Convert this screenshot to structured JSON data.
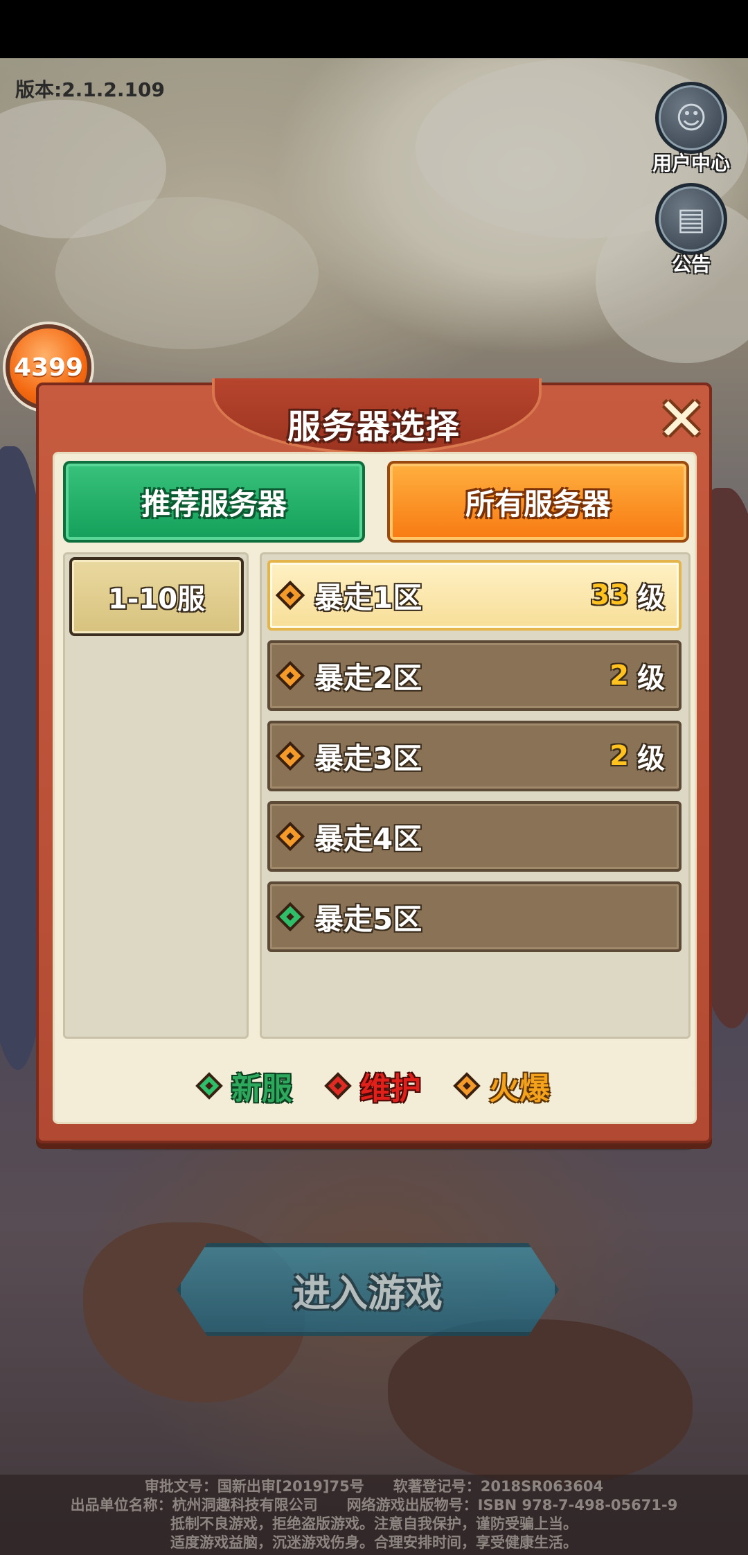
{
  "version_label": "版本:2.1.2.109",
  "side_buttons": {
    "user_center": "用户中心",
    "announcement": "公告"
  },
  "logo": "4399",
  "dialog": {
    "title": "服务器选择",
    "close_glyph": "✕",
    "tabs": {
      "recommended": "推荐服务器",
      "all": "所有服务器"
    },
    "range": "1-10服",
    "servers": [
      {
        "name": "暴走1区",
        "level": "33",
        "unit": "级",
        "status": "hot"
      },
      {
        "name": "暴走2区",
        "level": "2",
        "unit": "级",
        "status": "hot"
      },
      {
        "name": "暴走3区",
        "level": "2",
        "unit": "级",
        "status": "hot"
      },
      {
        "name": "暴走4区",
        "level": "",
        "unit": "",
        "status": "hot"
      },
      {
        "name": "暴走5区",
        "level": "",
        "unit": "",
        "status": "new"
      }
    ],
    "legend": {
      "new": "新服",
      "maintenance": "维护",
      "hot": "火爆"
    }
  },
  "enter_game": "进入游戏",
  "footer": {
    "line1": "审批文号：国新出审[2019]75号　　软著登记号：2018SR063604",
    "line2": "出品单位名称：杭州洞趣科技有限公司　　网络游戏出版物号：ISBN 978-7-498-05671-9",
    "line3": "抵制不良游戏，拒绝盗版游戏。注意自我保护，谨防受骗上当。",
    "line4": "适度游戏益脑，沉迷游戏伤身。合理安排时间，享受健康生活。"
  },
  "colors": {
    "new": "#2fbf6a",
    "maintenance": "#e02a24",
    "hot": "#f39a2a",
    "tab_recommended": "#14a05a",
    "tab_all": "#f77a12"
  }
}
